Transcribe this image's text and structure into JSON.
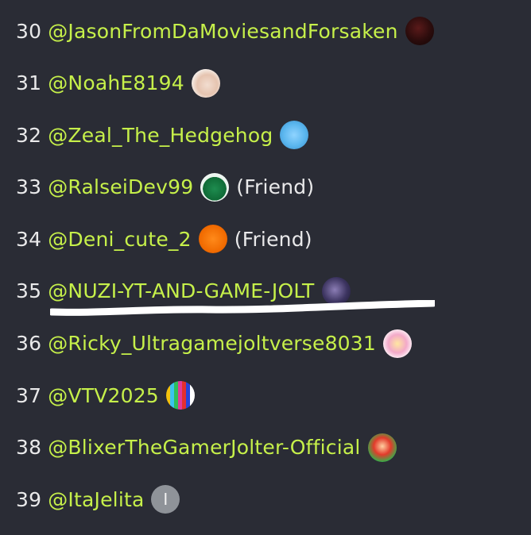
{
  "rows": [
    {
      "num": "30",
      "handle": "@JasonFromDaMoviesandForsaken",
      "avatar": "av-dark",
      "tag": ""
    },
    {
      "num": "31",
      "handle": "@NoahE8194",
      "avatar": "av-skin",
      "tag": ""
    },
    {
      "num": "32",
      "handle": "@Zeal_The_Hedgehog",
      "avatar": "av-blue",
      "tag": ""
    },
    {
      "num": "33",
      "handle": "@RalseiDev99",
      "avatar": "av-green",
      "tag": "(Friend)"
    },
    {
      "num": "34",
      "handle": "@Deni_cute_2",
      "avatar": "av-orange",
      "tag": "(Friend)"
    },
    {
      "num": "35",
      "handle": "@NUZI-YT-AND-GAME-JOLT",
      "avatar": "av-purple",
      "tag": ""
    },
    {
      "num": "36",
      "handle": "@Ricky_Ultragamejoltverse8031",
      "avatar": "av-pink",
      "tag": ""
    },
    {
      "num": "37",
      "handle": "@VTV2025",
      "avatar": "av-rainbow",
      "tag": ""
    },
    {
      "num": "38",
      "handle": "@BlixerTheGamerJolter-Official",
      "avatar": "av-mario",
      "tag": ""
    },
    {
      "num": "39",
      "handle": "@ItaJelita",
      "avatar": "av-letter",
      "tag": ""
    }
  ],
  "avatar_letter": "I",
  "colors": {
    "background": "#2a2c35",
    "handle": "#c6f04a",
    "text": "#e9e9ea",
    "underline": "#ffffff"
  }
}
